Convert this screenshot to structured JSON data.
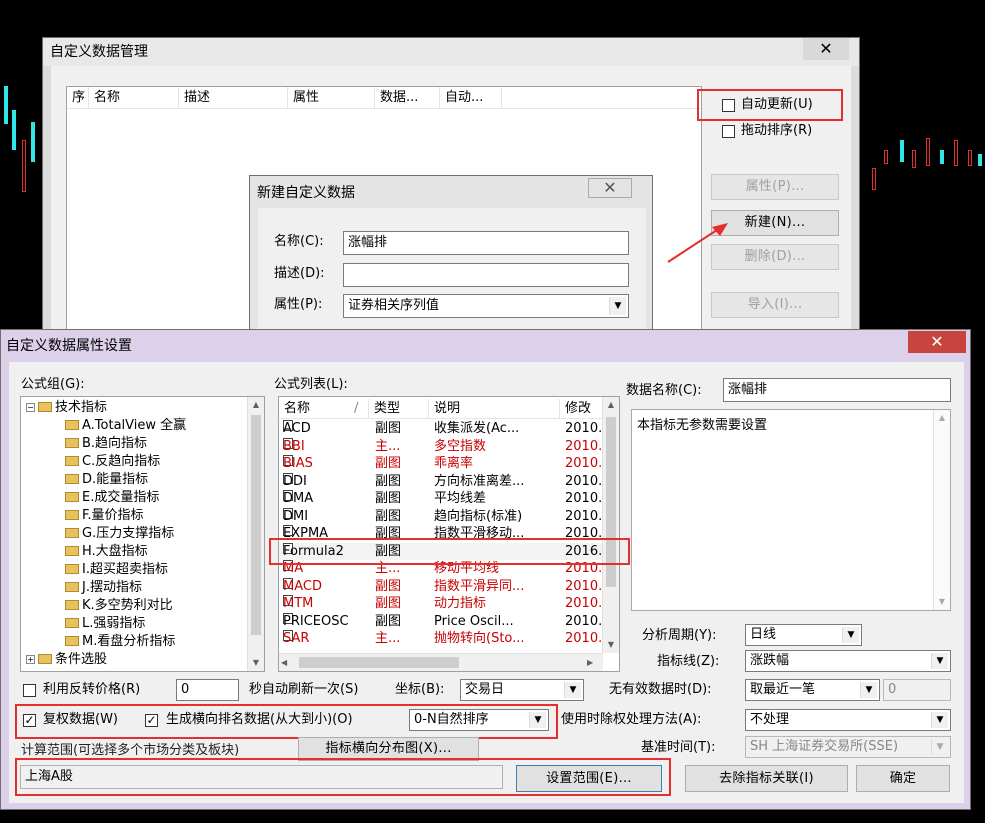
{
  "main_window": {
    "title": "自定义数据管理",
    "close_label": "✕",
    "columns": [
      "序",
      "名称",
      "描述",
      "属性",
      "数据...",
      "自动..."
    ],
    "auto_update_label": "自动更新(U)",
    "drag_sort_label": "拖动排序(R)",
    "buttons": {
      "properties": "属性(P)...",
      "new": "新建(N)...",
      "delete": "删除(D)...",
      "import": "导入(I)..."
    }
  },
  "new_dialog": {
    "title": "新建自定义数据",
    "close_label": "✕",
    "name_label": "名称(C):",
    "name_value": "涨幅排",
    "desc_label": "描述(D):",
    "desc_value": "",
    "attr_label": "属性(P):",
    "attr_value": "证券相关序列值"
  },
  "props_dialog": {
    "title": "自定义数据属性设置",
    "close_label": "✕",
    "formula_group_label": "公式组(G):",
    "formula_list_label": "公式列表(L):",
    "data_name_label": "数据名称(C):",
    "data_name_value": "涨幅排",
    "param_text": "本指标无参数需要设置",
    "tree": {
      "root": "技术指标",
      "children": [
        "A.TotalView 全赢",
        "B.趋向指标",
        "C.反趋向指标",
        "D.能量指标",
        "E.成交量指标",
        "F.量价指标",
        "G.压力支撑指标",
        "H.大盘指标",
        "I.超买超卖指标",
        "J.摆动指标",
        "K.多空势利对比",
        "L.强弱指标",
        "M.看盘分析指标"
      ],
      "last": "条件选股"
    },
    "list_headers": {
      "name": "名称",
      "type": "类型",
      "desc": "说明",
      "mod": "修改"
    },
    "formulas": [
      {
        "name": "ACD",
        "type": "副图",
        "desc": "收集派发(Ac...",
        "mod": "2010.",
        "red": false
      },
      {
        "name": "BBI",
        "type": "主...",
        "desc": "多空指数",
        "mod": "2010.",
        "red": true
      },
      {
        "name": "BIAS",
        "type": "副图",
        "desc": "乖离率",
        "mod": "2010.",
        "red": true
      },
      {
        "name": "DDI",
        "type": "副图",
        "desc": "方向标准离差...",
        "mod": "2010.",
        "red": false
      },
      {
        "name": "DMA",
        "type": "副图",
        "desc": "平均线差",
        "mod": "2010.",
        "red": false
      },
      {
        "name": "DMI",
        "type": "副图",
        "desc": "趋向指标(标准)",
        "mod": "2010.",
        "red": false
      },
      {
        "name": "EXPMA",
        "type": "副图",
        "desc": "指数平滑移动...",
        "mod": "2010.",
        "red": false
      },
      {
        "name": "Formula2",
        "type": "副图",
        "desc": "",
        "mod": "2016.",
        "red": false
      },
      {
        "name": "MA",
        "type": "主...",
        "desc": "移动平均线",
        "mod": "2010.",
        "red": true
      },
      {
        "name": "MACD",
        "type": "副图",
        "desc": "指数平滑异同...",
        "mod": "2010.",
        "red": true
      },
      {
        "name": "MTM",
        "type": "副图",
        "desc": "动力指标",
        "mod": "2010.",
        "red": true
      },
      {
        "name": "PRICEOSC",
        "type": "副图",
        "desc": "Price Oscil...",
        "mod": "2010.",
        "red": false
      },
      {
        "name": "SAR",
        "type": "主...",
        "desc": "抛物转向(Sto...",
        "mod": "2010.",
        "red": true
      }
    ],
    "period_label": "分析周期(Y):",
    "period_value": "日线",
    "indicator_line_label": "指标线(Z):",
    "indicator_line_value": "涨跌幅",
    "use_reverse_label": "利用反转价格(R)",
    "refresh_value": "0",
    "refresh_label": "秒自动刷新一次(S)",
    "coord_label": "坐标(B):",
    "coord_value": "交易日",
    "invalid_time_label": "无有效数据时(D):",
    "invalid_value": "取最近一笔",
    "invalid_num": "0",
    "adjust_label": "复权数据(W)",
    "rank_label": "生成横向排名数据(从大到小)(O)",
    "rank_value": "0-N自然排序",
    "exright_label": "使用时除权处理方法(A):",
    "exright_value": "不处理",
    "calc_range_label": "计算范围(可选择多个市场分类及板块)",
    "dist_btn": "指标横向分布图(X)...",
    "base_time_label": "基准时间(T):",
    "base_time_value": "SH 上海证券交易所(SSE)",
    "range_value": "上海A股",
    "set_range_btn": "设置范围(E)...",
    "remove_btn": "去除指标关联(I)",
    "ok_btn": "确定"
  }
}
